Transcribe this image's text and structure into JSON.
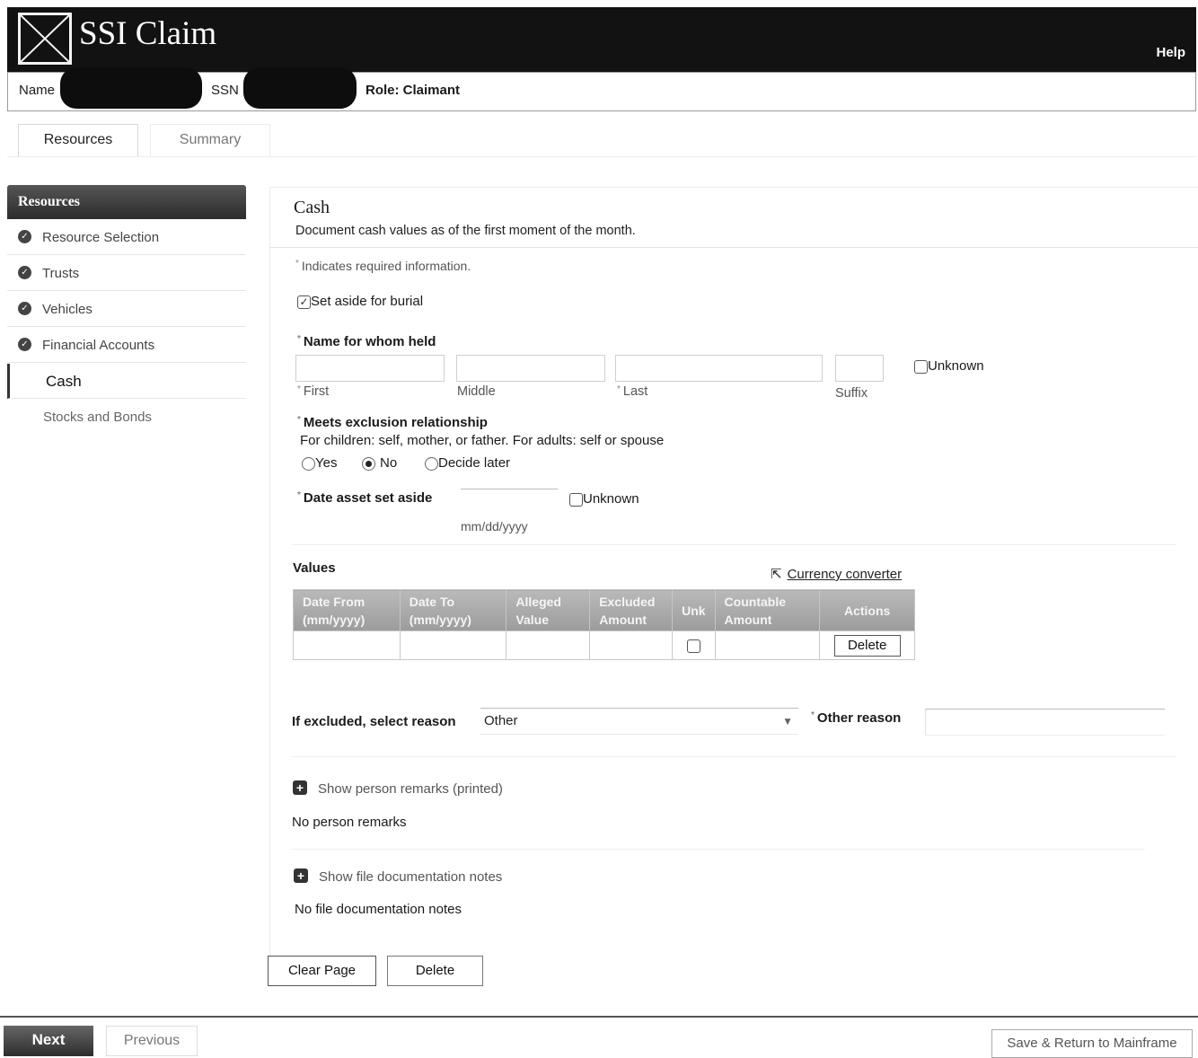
{
  "header": {
    "title": "SSI Claim",
    "help": "Help",
    "name_label": "Name",
    "ssn_label": "SSN",
    "role_label": "Role: Claimant"
  },
  "tabs": [
    {
      "label": "Resources",
      "active": true
    },
    {
      "label": "Summary",
      "active": false
    }
  ],
  "sidebar": {
    "heading": "Resources",
    "items": [
      {
        "label": "Resource Selection",
        "completed": true
      },
      {
        "label": "Trusts",
        "completed": true
      },
      {
        "label": "Vehicles",
        "completed": true
      },
      {
        "label": "Financial Accounts",
        "completed": true
      },
      {
        "label": "Cash",
        "active": true
      },
      {
        "label": "Stocks and Bonds"
      }
    ]
  },
  "main": {
    "title": "Cash",
    "subtitle": "Document cash values as of the first moment of the month.",
    "required_note": "Indicates required information.",
    "burial": {
      "label": "Set aside for burial",
      "checked": true
    },
    "name_held": {
      "label": "Name for whom held",
      "first": "First",
      "middle": "Middle",
      "last": "Last",
      "suffix": "Suffix",
      "unknown": "Unknown"
    },
    "exclusion": {
      "label": "Meets exclusion relationship",
      "help": "For children: self, mother, or father. For adults: self or spouse",
      "options": [
        "Yes",
        "No",
        "Decide later"
      ],
      "selected": "No"
    },
    "date_set_aside": {
      "label": "Date asset set aside",
      "format": "mm/dd/yyyy",
      "unknown": "Unknown"
    },
    "values": {
      "title": "Values",
      "currency_link": "Currency converter",
      "headers": [
        "Date From (mm/yyyy)",
        "Date To (mm/yyyy)",
        "Alleged Value",
        "Excluded Amount",
        "Unk",
        "Countable Amount",
        "Actions"
      ],
      "row_delete": "Delete"
    },
    "excluded_reason": {
      "label": "If excluded, select reason",
      "value": "Other",
      "other_label": "Other reason"
    },
    "remarks": {
      "toggle": "Show person remarks (printed)",
      "empty": "No person remarks"
    },
    "docs": {
      "toggle": "Show file documentation notes",
      "empty": "No file documentation notes"
    },
    "clear_button": "Clear Page",
    "delete_button": "Delete"
  },
  "footer": {
    "next": "Next",
    "previous": "Previous",
    "save": "Save & Return to Mainframe"
  }
}
